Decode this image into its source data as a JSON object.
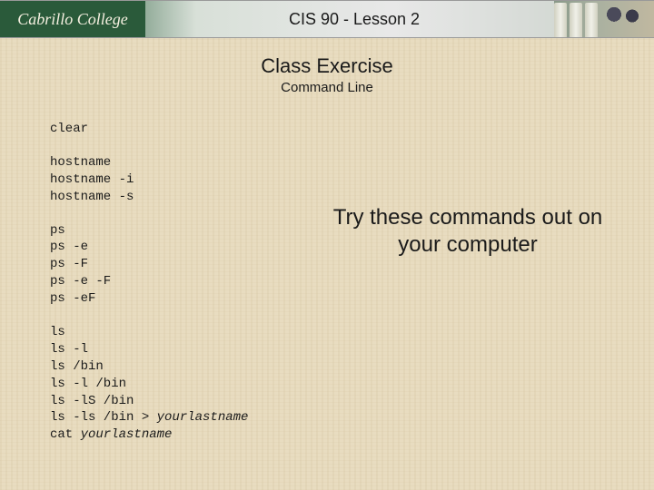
{
  "header": {
    "logo_text": "Cabrillo College",
    "title": "CIS 90 - Lesson 2"
  },
  "title": {
    "main": "Class Exercise",
    "sub": "Command Line"
  },
  "code": {
    "clear": "clear",
    "hostname": "hostname\nhostname -i\nhostname -s",
    "ps": "ps\nps -e\nps -F\nps -e -F\nps -eF",
    "ls_pre": "ls\nls -l\nls /bin\nls -l /bin\nls -lS /bin\nls -ls /bin > ",
    "ls_arg1": "yourlastname",
    "cat_pre": "cat ",
    "cat_arg": "yourlastname"
  },
  "callout": "Try these commands out on your computer"
}
